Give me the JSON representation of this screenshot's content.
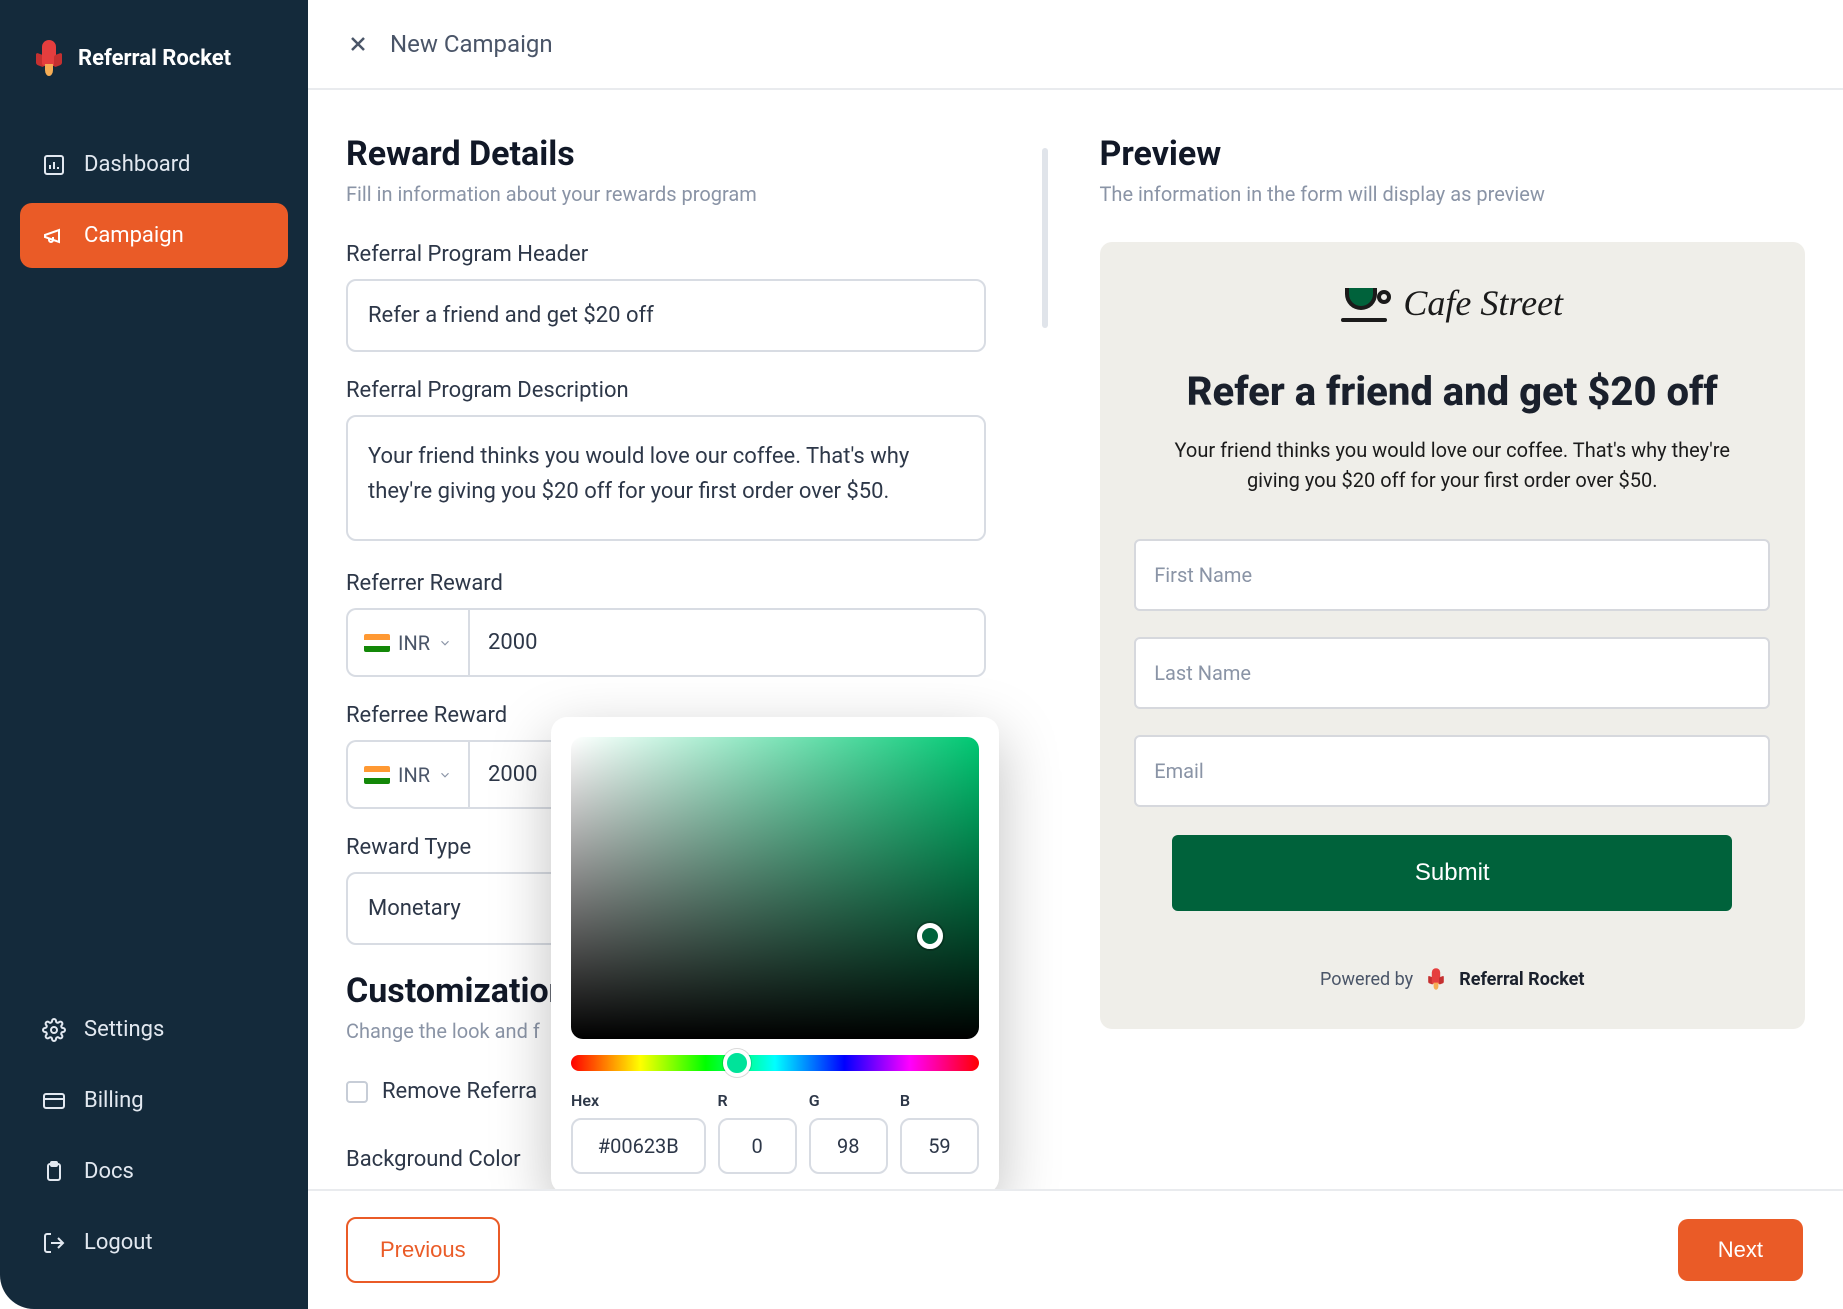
{
  "brand": {
    "name": "Referral Rocket"
  },
  "sidebar": {
    "top": [
      {
        "label": "Dashboard",
        "icon": "dashboard-icon"
      },
      {
        "label": "Campaign",
        "icon": "megaphone-icon",
        "active": true
      }
    ],
    "bottom": [
      {
        "label": "Settings",
        "icon": "gear-icon"
      },
      {
        "label": "Billing",
        "icon": "card-icon"
      },
      {
        "label": "Docs",
        "icon": "clipboard-icon"
      },
      {
        "label": "Logout",
        "icon": "logout-icon"
      }
    ]
  },
  "topbar": {
    "title": "New Campaign"
  },
  "form": {
    "section_title": "Reward Details",
    "section_sub": "Fill in information about your rewards program",
    "header_label": "Referral Program Header",
    "header_value": "Refer a friend and get $20 off",
    "desc_label": "Referral Program Description",
    "desc_value": "Your friend thinks you would love our coffee. That's why they're giving you $20 off for your first order over $50.",
    "referrer_label": "Referrer Reward",
    "referrer_currency": "INR",
    "referrer_amount": "2000",
    "referree_label": "Referree Reward",
    "referree_currency": "INR",
    "referree_amount": "2000",
    "rewardtype_label": "Reward Type",
    "rewardtype_value": "Monetary",
    "custom_title": "Customization",
    "custom_sub": "Change the look and f",
    "remove_label": "Remove Referra",
    "bgcolor_label": "Background Color",
    "bgcolor_value": "#00623B"
  },
  "picker": {
    "hex_label": "Hex",
    "r_label": "R",
    "g_label": "G",
    "b_label": "B",
    "hex": "#00623B",
    "r": "0",
    "g": "98",
    "b": "59"
  },
  "preview": {
    "title": "Preview",
    "sub": "The information in the form will display as preview",
    "logo_text": "Cafe Street",
    "headline": "Refer a friend and get $20 off",
    "desc": "Your friend thinks you would love our coffee. That's why they're giving you $20 off for your first order over $50.",
    "placeholders": {
      "first": "First Name",
      "last": "Last Name",
      "email": "Email"
    },
    "submit": "Submit",
    "powered_pre": "Powered by",
    "powered_brand": "Referral Rocket"
  },
  "footer": {
    "prev": "Previous",
    "next": "Next"
  }
}
